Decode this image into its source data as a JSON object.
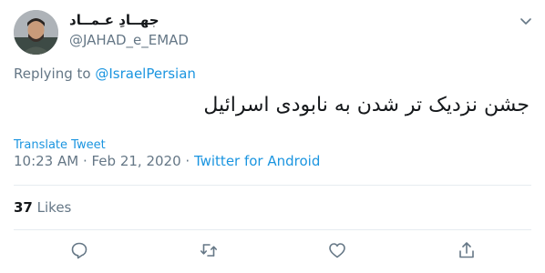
{
  "user": {
    "display_name": "جهــادِ عـمــاد",
    "handle": "@JAHAD_e_EMAD"
  },
  "reply": {
    "prefix": "Replying to ",
    "to": "@IsraelPersian"
  },
  "tweet": {
    "text": "جشن نزدیک تر شدن به نابودی اسرائیل",
    "translate_label": "Translate Tweet",
    "time": "10:23 AM · Feb 21, 2020 · ",
    "source": "Twitter for Android"
  },
  "stats": {
    "likes_count": "37",
    "likes_label": " Likes"
  },
  "colors": {
    "link": "#1b95e0",
    "muted": "#657786",
    "text": "#14171a",
    "divider": "#e6ecf0"
  },
  "icons": [
    "more-caret-icon",
    "reply-icon",
    "retweet-icon",
    "like-icon",
    "share-icon"
  ]
}
